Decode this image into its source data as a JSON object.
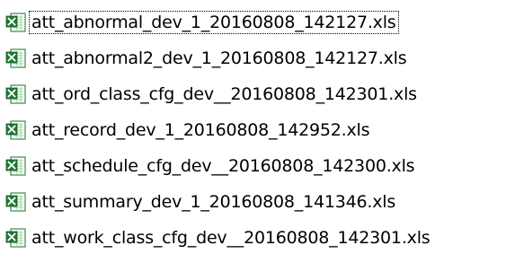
{
  "files": [
    {
      "name": "att_abnormal_dev_1_20160808_142127.xls",
      "icon": "excel-file-icon",
      "focused": true
    },
    {
      "name": "att_abnormal2_dev_1_20160808_142127.xls",
      "icon": "excel-file-icon",
      "focused": false
    },
    {
      "name": "att_ord_class_cfg_dev__20160808_142301.xls",
      "icon": "excel-file-icon",
      "focused": false
    },
    {
      "name": "att_record_dev_1_20160808_142952.xls",
      "icon": "excel-file-icon",
      "focused": false
    },
    {
      "name": "att_schedule_cfg_dev__20160808_142300.xls",
      "icon": "excel-file-icon",
      "focused": false
    },
    {
      "name": "att_summary_dev_1_20160808_141346.xls",
      "icon": "excel-file-icon",
      "focused": false
    },
    {
      "name": "att_work_class_cfg_dev__20160808_142301.xls",
      "icon": "excel-file-icon",
      "focused": false
    }
  ],
  "colors": {
    "icon_green": "#1e7a34",
    "icon_light": "#bfe3b8",
    "text": "#000000"
  }
}
